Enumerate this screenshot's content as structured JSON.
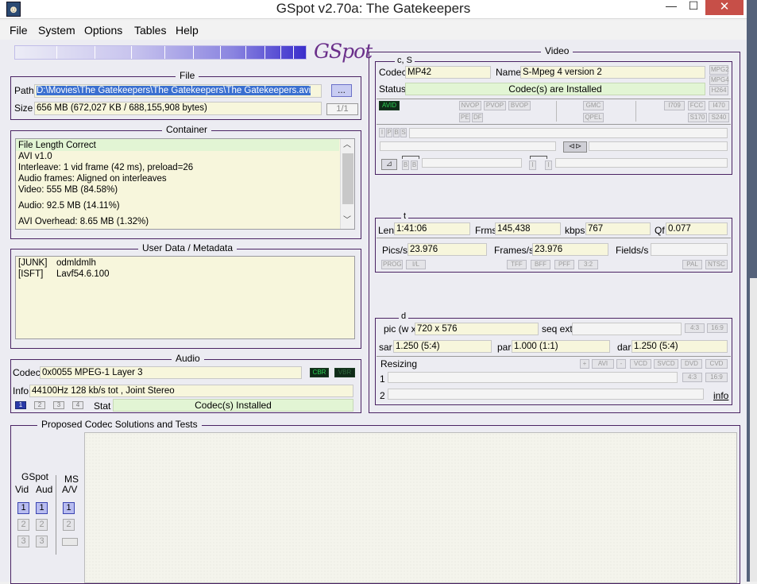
{
  "window": {
    "title": "GSpot v2.70a: The Gatekeepers",
    "minimize_glyph": "—",
    "maximize_glyph": "☐",
    "close_glyph": "✕"
  },
  "menu": [
    "File",
    "System",
    "Options",
    "Tables",
    "Help"
  ],
  "logo_text": "GSpot",
  "file": {
    "label": "File",
    "path_label": "Path",
    "path_value": "D:\\Movies\\The Gatekeepers\\The Gatekeepers\\The Gatekeepers.avi",
    "browse_label": "...",
    "size_label": "Size",
    "size_value": "656 MB (672,027 KB / 688,155,908 bytes)",
    "page_indicator": "1/1"
  },
  "container": {
    "label": "Container",
    "lines": [
      "File Length Correct",
      "AVI v1.0",
      "Interleave: 1 vid frame (42 ms), preload=26",
      "Audio frames: Aligned on interleaves",
      "Video: 555 MB (84.58%)",
      "Audio: 92.5 MB (14.11%)",
      "AVI Overhead: 8.65 MB (1.32%)"
    ]
  },
  "metadata": {
    "label": "User Data / Metadata",
    "rows": [
      {
        "key": "[JUNK]",
        "value": "odmldmlh"
      },
      {
        "key": "[ISFT]",
        "value": "Lavf54.6.100"
      }
    ]
  },
  "audio": {
    "label": "Audio",
    "codec_label": "Codec",
    "codec_value": "0x0055 MPEG-1 Layer 3",
    "cbr_tag": "CBR",
    "vbr_tag": "VBR",
    "info_label": "Info",
    "info_value": "44100Hz  128 kb/s tot , Joint Stereo",
    "tabs": [
      "1",
      "2",
      "3",
      "4"
    ],
    "stat_label": "Stat",
    "stat_value": "Codec(s) Installed"
  },
  "video": {
    "label": "Video",
    "cs_label": "c, S",
    "codec_label": "Codec",
    "codec_value": "MP42",
    "name_label": "Name",
    "name_value": "S-Mpeg 4 version 2",
    "status_label": "Status",
    "status_value": "Codec(s) are Installed",
    "mpeg_tags": [
      "MPG2",
      "MPG4",
      "H264"
    ],
    "avid_tag": "AVID",
    "vop_tags": [
      "NVOP",
      "PVOP",
      "BVOP"
    ],
    "pe_tags": [
      "PE",
      "DF"
    ],
    "gmc_tags": [
      "GMC",
      "QPEL"
    ],
    "std_tags": [
      "I709",
      "FCC",
      "I470",
      "S170",
      "S240"
    ],
    "frame_tags": [
      "I",
      "P",
      "B",
      "S"
    ],
    "bb_tags": [
      "B",
      "B"
    ],
    "i_tags": [
      "I",
      "I"
    ],
    "t_label": "t",
    "len_label": "Len",
    "len_value": "1:41:06",
    "frms_label": "Frms",
    "frms_value": "145,438",
    "kbps_label": "kbps",
    "kbps_value": "767",
    "qf_label": "Qf",
    "qf_value": "0.077",
    "pics_label": "Pics/s",
    "pics_value": "23.976",
    "frames_label": "Frames/s",
    "frames_value": "23.976",
    "fields_label": "Fields/s",
    "fields_value": "",
    "prog_tags": [
      "PROG",
      "I/L"
    ],
    "field_tags": [
      "TFF",
      "BFF",
      "PFF",
      "3:2"
    ],
    "fmt_tags": [
      "PAL",
      "NTSC"
    ],
    "d_label": "d",
    "pic_label": "pic (w x",
    "pic_value": "720 x 576",
    "seq_label": "seq ext",
    "seq_value": "",
    "ar_tags": [
      "4:3",
      "16:9"
    ],
    "sar_label": "sar",
    "sar_value": "1.250 (5:4)",
    "par_label": "par",
    "par_value": "1.000 (1:1)",
    "dar_label": "dar",
    "dar_value": "1.250 (5:4)",
    "resizing_label": "Resizing",
    "resize_tags": [
      "+",
      "AVI",
      "-",
      "VCD",
      "SVCD",
      "DVD",
      "CVD"
    ],
    "ar2_tags": [
      "4:3",
      "16:9"
    ],
    "row1_label": "1",
    "row2_label": "2",
    "info_link": "info"
  },
  "codec_solutions": {
    "label": "Proposed Codec Solutions and Tests",
    "gspot_label": "GSpot",
    "vid_label": "Vid",
    "aud_label": "Aud",
    "ms_label": "MS",
    "av_label": "A/V",
    "vid_buttons": [
      "1",
      "2",
      "3"
    ],
    "aud_buttons": [
      "1",
      "2",
      "3"
    ],
    "ms_buttons": [
      "1",
      "2"
    ]
  }
}
